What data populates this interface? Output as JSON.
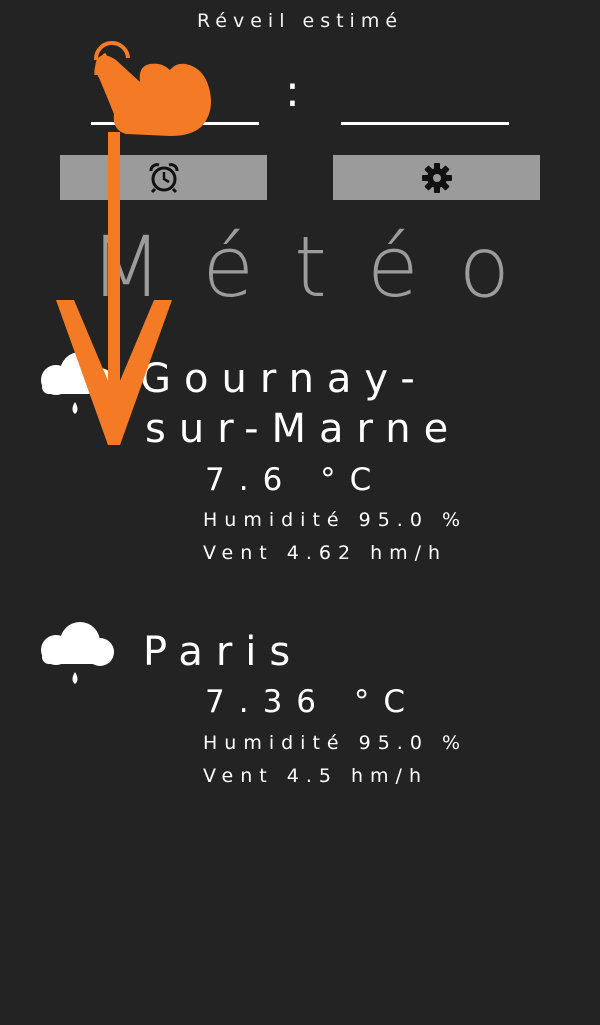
{
  "header": {
    "label": "Réveil estimé",
    "separator": ":"
  },
  "buttons": {
    "alarm_icon": "alarm-clock-icon",
    "settings_icon": "gear-icon"
  },
  "page": {
    "title": "Météo"
  },
  "cities": [
    {
      "name_line1": "Gournay-",
      "name_line2": "sur-Marne",
      "temperature": "7.6 °C",
      "humidity": "Humidité 95.0 %",
      "wind": "Vent 4.62 hm/h",
      "icon": "rain-cloud-icon"
    },
    {
      "name_line1": "Paris",
      "temperature": "7.36 °C",
      "humidity": "Humidité 95.0 %",
      "wind": "Vent 4.5 hm/h",
      "icon": "rain-cloud-icon"
    }
  ],
  "colors": {
    "background": "#232323",
    "button": "#9b9b9b",
    "title": "#9c9c9c",
    "gesture": "#f47a26"
  },
  "gesture": {
    "type": "swipe-down",
    "icon": "hand-pointer-icon"
  }
}
